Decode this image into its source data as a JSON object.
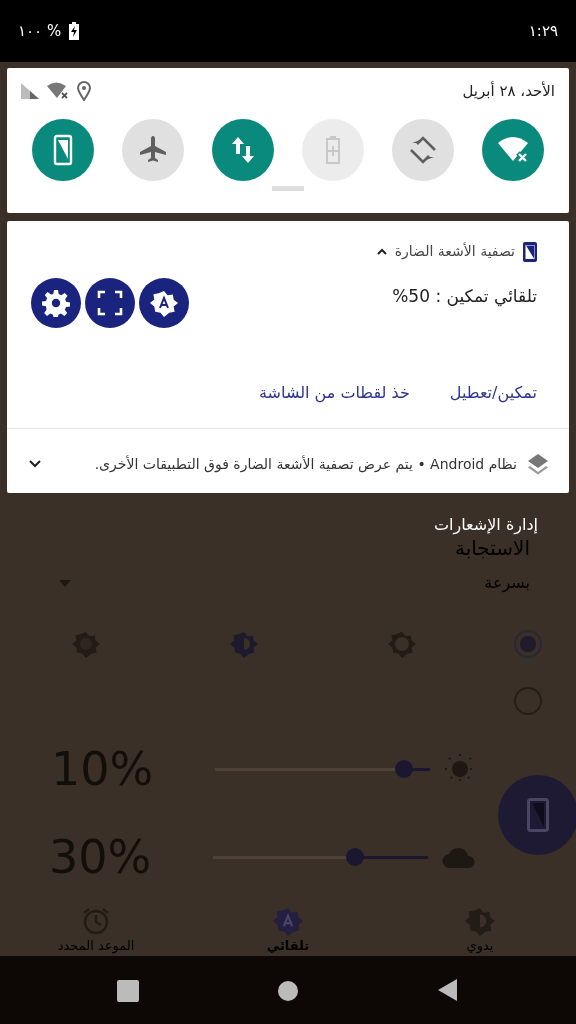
{
  "status_bar": {
    "battery": "% ١٠٠",
    "time": "١:٢٩"
  },
  "quick_settings": {
    "date": "الأحد، ٢٨ أبريل",
    "tiles": [
      {
        "kind": "wifi",
        "on": true,
        "disabled": false
      },
      {
        "kind": "rotate",
        "on": false,
        "disabled": false
      },
      {
        "kind": "battery",
        "on": false,
        "disabled": true
      },
      {
        "kind": "data",
        "on": true,
        "disabled": false
      },
      {
        "kind": "airplane",
        "on": false,
        "disabled": false
      },
      {
        "kind": "filter",
        "on": true,
        "disabled": false
      }
    ]
  },
  "notification": {
    "app": "تصفية الأشعة الضارة",
    "expanded": true,
    "text": "تلقائي تمكين : 50%",
    "actions": [
      "تمكين/تعطيل",
      "خذ لقطات من الشاشة"
    ]
  },
  "system_notification": {
    "text": "نظام Android • يتم عرض تصفية الأشعة الضارة فوق التطبيقات الأخرى.",
    "expanded": false
  },
  "manage_button": "إدارة الإشعارات",
  "app": {
    "title": "الاستجابة",
    "speed": "بسرعة",
    "options": [
      {
        "selected": true
      },
      {
        "selected": false
      }
    ],
    "sliders": [
      {
        "kind": "sun",
        "reading": "10%",
        "level": 0.12
      },
      {
        "kind": "cloud",
        "reading": "30%",
        "level": 0.34
      }
    ],
    "nav": [
      {
        "kind": "manual",
        "label": "يدوي",
        "selected": false
      },
      {
        "kind": "auto",
        "label": "تلقائي",
        "selected": true
      },
      {
        "kind": "schedule",
        "label": "الموعد المحدد",
        "selected": false
      }
    ]
  }
}
